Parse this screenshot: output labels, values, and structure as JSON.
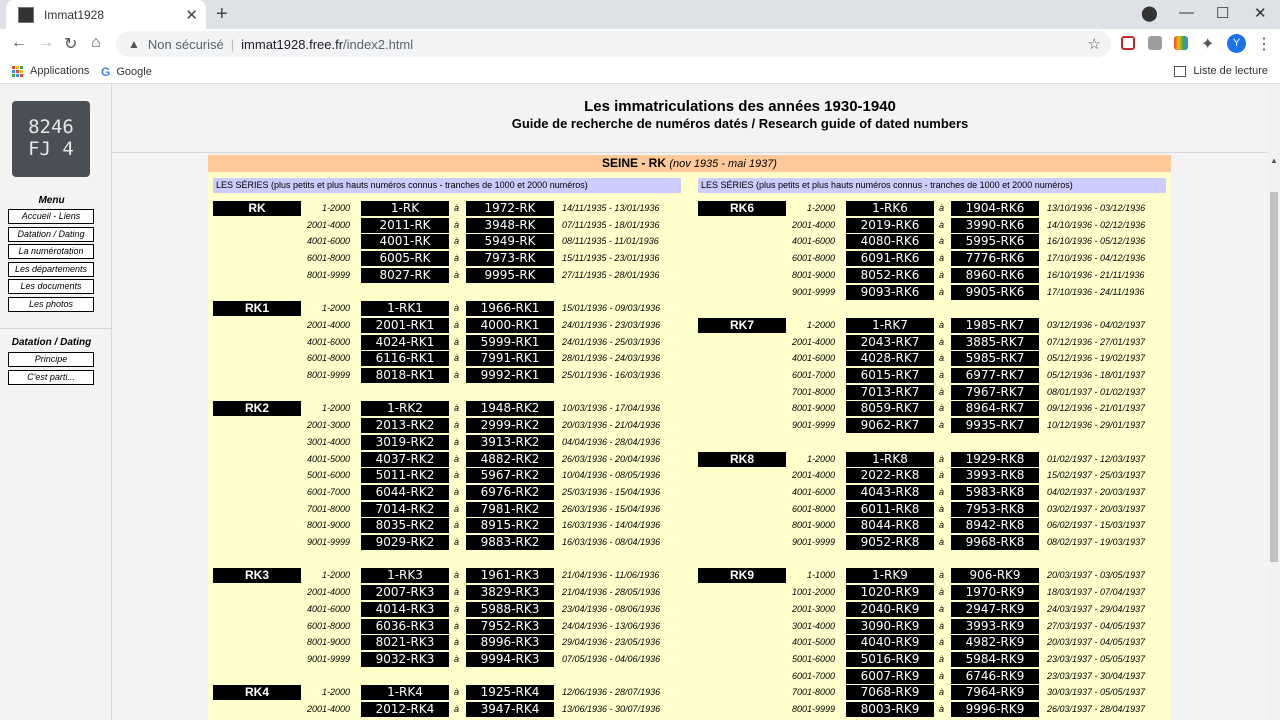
{
  "browser": {
    "tab_title": "Immat1928",
    "address_warning": "Non sécurisé",
    "url_host": "immat1928.free.fr",
    "url_path": "/index2.html",
    "bookmarks": [
      "Applications",
      "Google"
    ],
    "reading_list": "Liste de lecture",
    "profile_initial": "Y"
  },
  "sidebar": {
    "plate_line1": "8246",
    "plate_line2": "FJ 4",
    "menu_heading": "Menu",
    "menu_items": [
      "Accueil - Liens",
      "Datation / Dating",
      "La numérotation",
      "Les départements",
      "Les documents",
      "Les photos"
    ],
    "dating_heading": "Datation / Dating",
    "dating_items": [
      "Principe",
      "C'est parti..."
    ]
  },
  "header": {
    "title": "Les immatriculations des années 1930-1940",
    "subtitle": "Guide de recherche de numéros datés / Research guide of dated numbers"
  },
  "panel": {
    "title_bold": "SEINE - RK",
    "title_italic": "(nov 1935 - mai 1937)",
    "column_heading": "LES SÉRIES (plus petits et plus hauts numéros connus - tranches de 1000 et 2000 numéros)",
    "a_label": "à"
  },
  "left_groups": [
    {
      "label": "RK",
      "start": 0,
      "rows": [
        [
          "1-2000",
          "1-RK",
          "1972-RK",
          "14/11/1935 - 13/01/1936"
        ],
        [
          "2001-4000",
          "2011-RK",
          "3948-RK",
          "07/11/1935 - 18/01/1936"
        ],
        [
          "4001-6000",
          "4001-RK",
          "5949-RK",
          "08/11/1935 - 11/01/1936"
        ],
        [
          "6001-8000",
          "6005-RK",
          "7973-RK",
          "15/11/1935 - 23/01/1936"
        ],
        [
          "8001-9999",
          "8027-RK",
          "9995-RK",
          "27/11/1935 - 28/01/1936"
        ]
      ]
    },
    {
      "label": "RK1",
      "start": 6,
      "rows": [
        [
          "1-2000",
          "1-RK1",
          "1966-RK1",
          "15/01/1936 - 09/03/1936"
        ],
        [
          "2001-4000",
          "2001-RK1",
          "4000-RK1",
          "24/01/1936 - 23/03/1936"
        ],
        [
          "4001-6000",
          "4024-RK1",
          "5999-RK1",
          "24/01/1936 - 25/03/1936"
        ],
        [
          "6001-8000",
          "6116-RK1",
          "7991-RK1",
          "28/01/1936 - 24/03/1936"
        ],
        [
          "8001-9999",
          "8018-RK1",
          "9992-RK1",
          "25/01/1936 - 16/03/1936"
        ]
      ]
    },
    {
      "label": "RK2",
      "start": 12,
      "rows": [
        [
          "1-2000",
          "1-RK2",
          "1948-RK2",
          "10/03/1936 - 17/04/1936"
        ],
        [
          "2001-3000",
          "2013-RK2",
          "2999-RK2",
          "20/03/1936 - 21/04/1936"
        ],
        [
          "3001-4000",
          "3019-RK2",
          "3913-RK2",
          "04/04/1936 - 28/04/1936"
        ],
        [
          "4001-5000",
          "4037-RK2",
          "4882-RK2",
          "26/03/1936 - 20/04/1936"
        ],
        [
          "5001-6000",
          "5011-RK2",
          "5967-RK2",
          "10/04/1936 - 08/05/1936"
        ],
        [
          "6001-7000",
          "6044-RK2",
          "6976-RK2",
          "25/03/1936 - 15/04/1936"
        ],
        [
          "7001-8000",
          "7014-RK2",
          "7981-RK2",
          "26/03/1936 - 15/04/1936"
        ],
        [
          "8001-9000",
          "8035-RK2",
          "8915-RK2",
          "16/03/1936 - 14/04/1936"
        ],
        [
          "9001-9999",
          "9029-RK2",
          "9883-RK2",
          "16/03/1936 - 08/04/1936"
        ]
      ]
    },
    {
      "label": "RK3",
      "start": 22,
      "rows": [
        [
          "1-2000",
          "1-RK3",
          "1961-RK3",
          "21/04/1936 - 11/06/1936"
        ],
        [
          "2001-4000",
          "2007-RK3",
          "3829-RK3",
          "21/04/1936 - 28/05/1936"
        ],
        [
          "4001-6000",
          "4014-RK3",
          "5988-RK3",
          "23/04/1936 - 08/06/1936"
        ],
        [
          "6001-8000",
          "6036-RK3",
          "7952-RK3",
          "24/04/1936 - 13/06/1936"
        ],
        [
          "8001-9000",
          "8021-RK3",
          "8996-RK3",
          "29/04/1936 - 23/05/1936"
        ],
        [
          "9001-9999",
          "9032-RK3",
          "9994-RK3",
          "07/05/1936 - 04/06/1936"
        ]
      ]
    },
    {
      "label": "RK4",
      "start": 29,
      "rows": [
        [
          "1-2000",
          "1-RK4",
          "1925-RK4",
          "12/06/1936 - 28/07/1936"
        ],
        [
          "2001-4000",
          "2012-RK4",
          "3947-RK4",
          "13/06/1936 - 30/07/1936"
        ]
      ]
    }
  ],
  "right_groups": [
    {
      "label": "RK6",
      "start": 0,
      "rows": [
        [
          "1-2000",
          "1-RK6",
          "1904-RK6",
          "13/10/1936 - 03/12/1936"
        ],
        [
          "2001-4000",
          "2019-RK6",
          "3990-RK6",
          "14/10/1936 - 02/12/1936"
        ],
        [
          "4001-6000",
          "4080-RK6",
          "5995-RK6",
          "16/10/1936 - 05/12/1936"
        ],
        [
          "6001-8000",
          "6091-RK6",
          "7776-RK6",
          "17/10/1936 - 04/12/1936"
        ],
        [
          "8001-9000",
          "8052-RK6",
          "8960-RK6",
          "16/10/1936 - 21/11/1936"
        ],
        [
          "9001-9999",
          "9093-RK6",
          "9905-RK6",
          "17/10/1936 - 24/11/1936"
        ]
      ]
    },
    {
      "label": "RK7",
      "start": 7,
      "rows": [
        [
          "1-2000",
          "1-RK7",
          "1985-RK7",
          "03/12/1936 - 04/02/1937"
        ],
        [
          "2001-4000",
          "2043-RK7",
          "3885-RK7",
          "07/12/1936 - 27/01/1937"
        ],
        [
          "4001-6000",
          "4028-RK7",
          "5985-RK7",
          "05/12/1936 - 19/02/1937"
        ],
        [
          "6001-7000",
          "6015-RK7",
          "6977-RK7",
          "05/12/1936 - 18/01/1937"
        ],
        [
          "7001-8000",
          "7013-RK7",
          "7967-RK7",
          "08/01/1937 - 01/02/1937"
        ],
        [
          "8001-9000",
          "8059-RK7",
          "8964-RK7",
          "09/12/1936 - 21/01/1937"
        ],
        [
          "9001-9999",
          "9062-RK7",
          "9935-RK7",
          "10/12/1936 - 29/01/1937"
        ]
      ]
    },
    {
      "label": "RK8",
      "start": 15,
      "rows": [
        [
          "1-2000",
          "1-RK8",
          "1929-RK8",
          "01/02/1937 - 12/03/1937"
        ],
        [
          "2001-4000",
          "2022-RK8",
          "3993-RK8",
          "15/02/1937 - 25/03/1937"
        ],
        [
          "4001-6000",
          "4043-RK8",
          "5983-RK8",
          "04/02/1937 - 20/03/1937"
        ],
        [
          "6001-8000",
          "6011-RK8",
          "7953-RK8",
          "03/02/1937 - 20/03/1937"
        ],
        [
          "8001-9000",
          "8044-RK8",
          "8942-RK8",
          "06/02/1937 - 15/03/1937"
        ],
        [
          "9001-9999",
          "9052-RK8",
          "9968-RK8",
          "08/02/1937 - 19/03/1937"
        ]
      ]
    },
    {
      "label": "RK9",
      "start": 22,
      "rows": [
        [
          "1-1000",
          "1-RK9",
          "906-RK9",
          "20/03/1937 - 03/05/1937"
        ],
        [
          "1001-2000",
          "1020-RK9",
          "1970-RK9",
          "18/03/1937 - 07/04/1937"
        ],
        [
          "2001-3000",
          "2040-RK9",
          "2947-RK9",
          "24/03/1937 - 29/04/1937"
        ],
        [
          "3001-4000",
          "3090-RK9",
          "3993-RK9",
          "27/03/1937 - 04/05/1937"
        ],
        [
          "4001-5000",
          "4040-RK9",
          "4982-RK9",
          "20/03/1937 - 04/05/1937"
        ],
        [
          "5001-6000",
          "5016-RK9",
          "5984-RK9",
          "23/03/1937 - 05/05/1937"
        ],
        [
          "6001-7000",
          "6007-RK9",
          "6746-RK9",
          "23/03/1937 - 30/04/1937"
        ],
        [
          "7001-8000",
          "7068-RK9",
          "7964-RK9",
          "30/03/1937 - 05/05/1937"
        ],
        [
          "8001-9999",
          "8003-RK9",
          "9996-RK9",
          "26/03/1937 - 28/04/1937"
        ]
      ]
    }
  ]
}
